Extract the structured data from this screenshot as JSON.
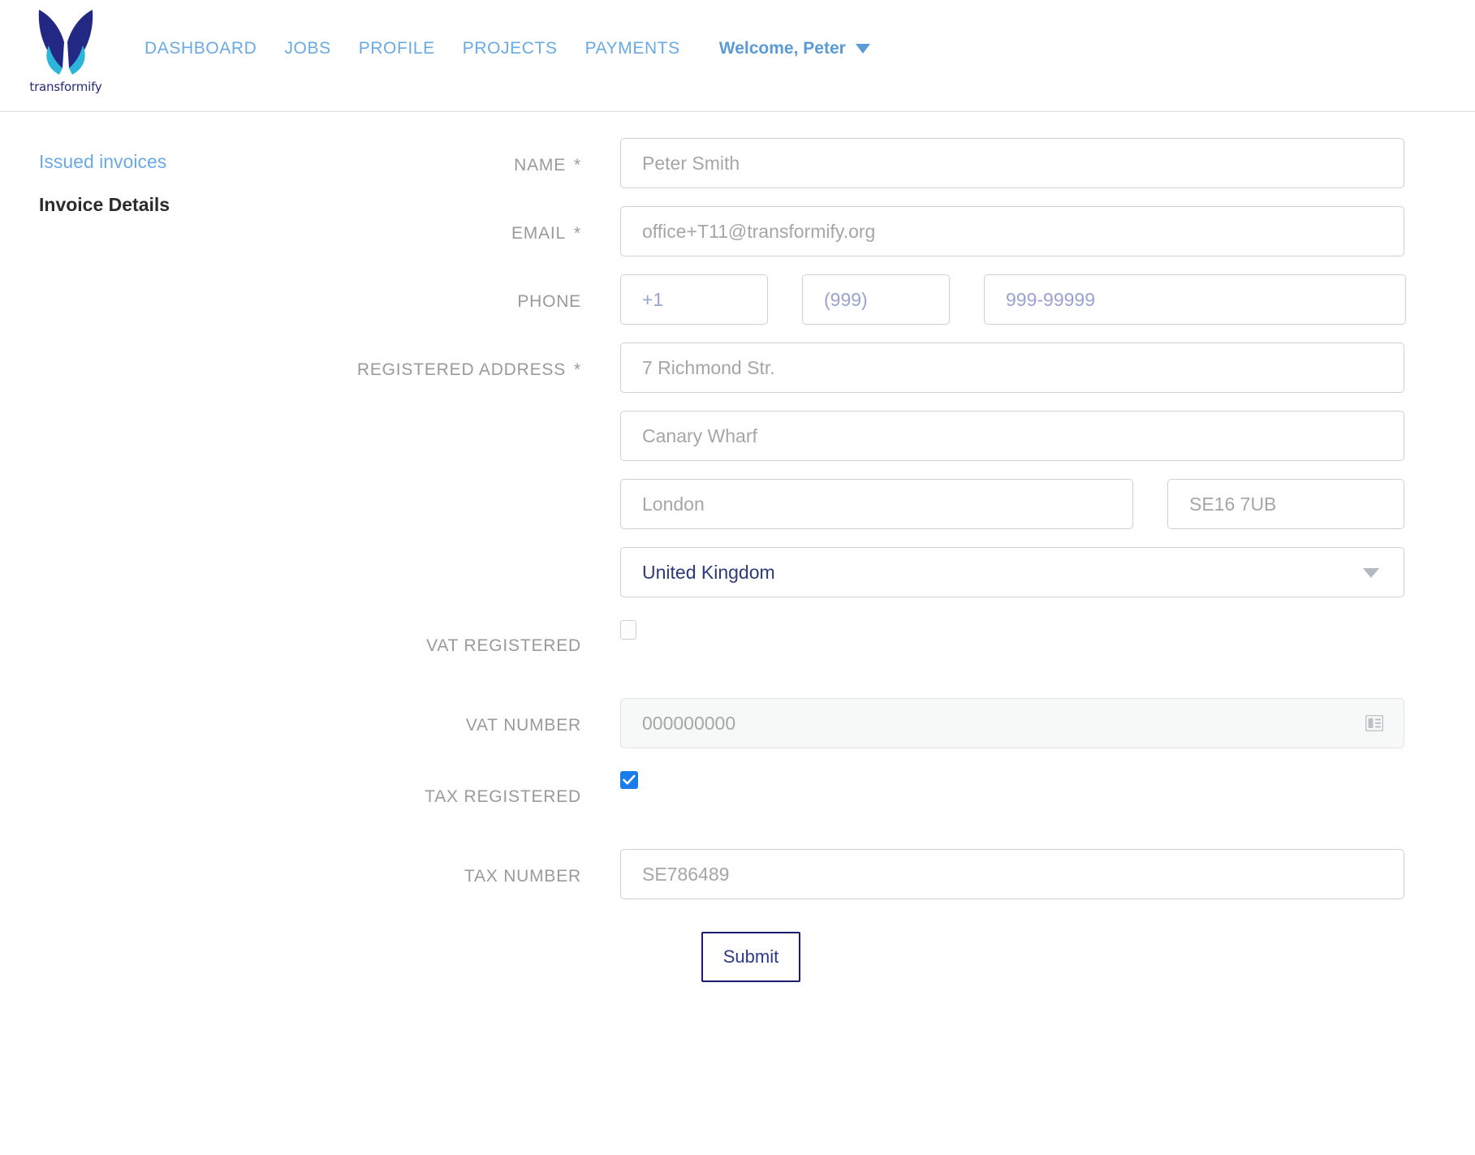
{
  "brand": {
    "wordmark": "transformify",
    "logo_icon": "butterfly-wings-logo",
    "navy": "#232884",
    "cyan": "#2cb5d8"
  },
  "header": {
    "nav_items": [
      {
        "label": "DASHBOARD",
        "name": "dashboard"
      },
      {
        "label": "JOBS",
        "name": "jobs"
      },
      {
        "label": "PROFILE",
        "name": "profile"
      },
      {
        "label": "PROJECTS",
        "name": "projects"
      },
      {
        "label": "PAYMENTS",
        "name": "payments"
      }
    ],
    "welcome": "Welcome, Peter",
    "welcome_caret_icon": "chevron-down-icon",
    "link_color": "#6aaae4"
  },
  "sidebar": {
    "issued_invoices": "Issued invoices",
    "invoice_details": "Invoice Details"
  },
  "form": {
    "name": {
      "label": "NAME",
      "required": "*",
      "value": "Peter Smith",
      "placeholder": "Peter Smith"
    },
    "email": {
      "label": "EMAIL",
      "required": "*",
      "value": "office+T11@transformify.org",
      "placeholder": "office+T11@transformify.org"
    },
    "phone": {
      "label": "PHONE",
      "country_code": "+1",
      "area_code": "(999)",
      "number": "999-99999"
    },
    "address": {
      "label": "REGISTERED ADDRESS",
      "required": "*",
      "line1": "7 Richmond Str.",
      "line2": "Canary Wharf",
      "city": "London",
      "postcode": "SE16 7UB",
      "country": "United Kingdom",
      "country_arrow_icon": "triangle-down-icon"
    },
    "vat_registered": {
      "label": "VAT REGISTERED",
      "checked": false
    },
    "vat_number": {
      "label": "VAT NUMBER",
      "placeholder": "000000000",
      "disabled": true,
      "trailing_icon": "id-card-icon"
    },
    "tax_registered": {
      "label": "TAX REGISTERED",
      "checked": true,
      "checkbox_color": "#1a7bed"
    },
    "tax_number": {
      "label": "TAX NUMBER",
      "value": "SE786489",
      "placeholder": "SE786489"
    },
    "submit_label": "Submit"
  }
}
